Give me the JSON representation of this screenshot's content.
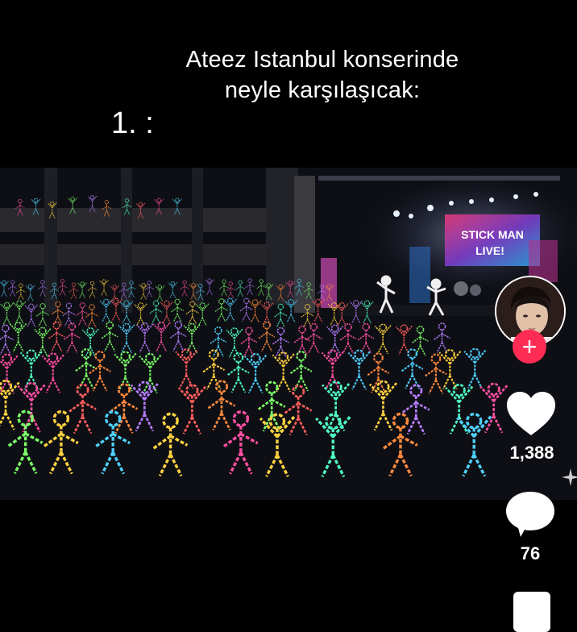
{
  "caption": {
    "line1": "Ateez Istanbul konserinde",
    "line2": "neyle karşılaşıcak:",
    "list_number": "1. :"
  },
  "media": {
    "screen_text_line1": "STICK MAN",
    "screen_text_line2": "LIVE!"
  },
  "actions": {
    "follow_label": "+",
    "likes": "1,388",
    "comments": "76"
  },
  "colors": {
    "follow_red": "#fe2c55",
    "background": "#000000"
  },
  "icons": [
    "heart-icon",
    "comment-bubble-icon",
    "bookmark-icon",
    "sparkle-icon",
    "plus-icon"
  ]
}
